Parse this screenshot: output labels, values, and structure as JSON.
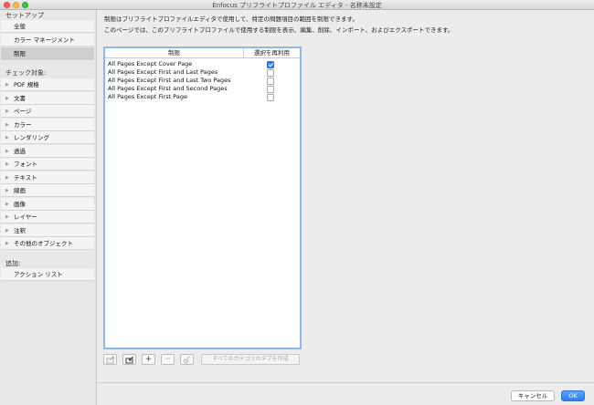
{
  "window": {
    "title": "Enfocus プリフライトプロファイル エディタ - 名称未設定"
  },
  "sidebar": {
    "setup_header": "セットアップ",
    "setup_items": [
      {
        "label": "全般"
      },
      {
        "label": "カラー マネージメント"
      },
      {
        "label": "制限"
      }
    ],
    "check_header": "チェック対象:",
    "check_items": [
      {
        "label": "PDF 規格"
      },
      {
        "label": "文書"
      },
      {
        "label": "ページ"
      },
      {
        "label": "カラー"
      },
      {
        "label": "レンダリング"
      },
      {
        "label": "透過"
      },
      {
        "label": "フォント"
      },
      {
        "label": "テキスト"
      },
      {
        "label": "線画"
      },
      {
        "label": "画像"
      },
      {
        "label": "レイヤー"
      },
      {
        "label": "注釈"
      },
      {
        "label": "その他のオブジェクト"
      }
    ],
    "add_header": "追加:",
    "add_items": [
      {
        "label": "アクション リスト"
      }
    ]
  },
  "main": {
    "description_1": "制限はプリフライトプロファイルエディタで使用して、特定の問題項目の範囲を制限できます。",
    "description_2": "このページでは、このプリフライトプロファイルで使用する制限を表示、編集、削除、インポート、およびエクスポートできます。",
    "table": {
      "col_restriction": "制限",
      "col_reuse": "選択を再利用",
      "rows": [
        {
          "name": "All Pages Except Cover Page",
          "checked": true
        },
        {
          "name": "All Pages Except First and Last Pages",
          "checked": false
        },
        {
          "name": "All Pages Except First and Last Two Pages",
          "checked": false
        },
        {
          "name": "All Pages Except First and Second Pages",
          "checked": false
        },
        {
          "name": "All Pages Except First Page",
          "checked": false
        }
      ]
    },
    "toolbar": {
      "export_icon": "export-icon",
      "import_icon": "import-icon",
      "add_label": "+",
      "remove_label": "−",
      "clean_icon": "broom-icon",
      "make_tabs_label": "すべてのカテゴリのタブを作成"
    }
  },
  "footer": {
    "cancel_label": "キャンセル",
    "ok_label": "OK"
  },
  "colors": {
    "accent": "#3b82f0",
    "selected_item": "#cfcfcf",
    "table_focus": "#8db8ea"
  }
}
